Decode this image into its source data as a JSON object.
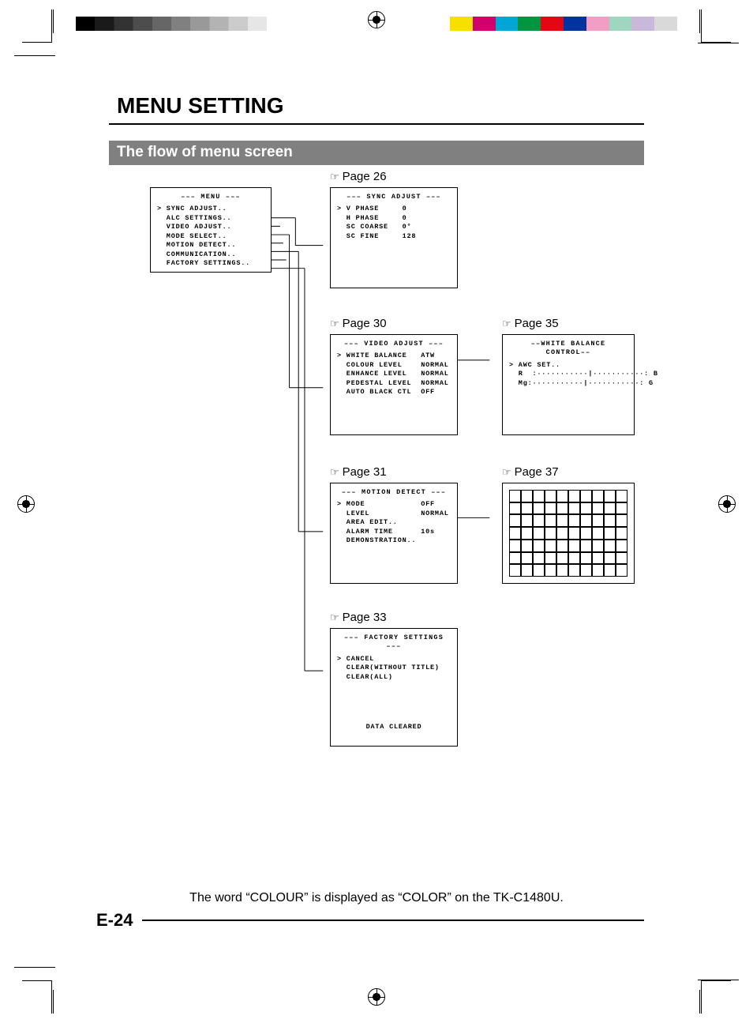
{
  "header": {
    "title": "MENU SETTING",
    "subtitle": "The flow of menu screen"
  },
  "refs": {
    "p26": "Page 26",
    "p30": "Page 30",
    "p31": "Page 31",
    "p33": "Page 33",
    "p35": "Page 35",
    "p37": "Page 37"
  },
  "boxes": {
    "menu": {
      "title": "––– MENU –––",
      "items": [
        "SYNC ADJUST..",
        "ALC SETTINGS..",
        "VIDEO ADJUST..",
        "MODE SELECT..",
        "MOTION DETECT..",
        "COMMUNICATION..",
        "FACTORY SETTINGS.."
      ]
    },
    "sync": {
      "title": "––– SYNC ADJUST –––",
      "rows": [
        {
          "label": "V PHASE",
          "value": "0"
        },
        {
          "label": "H PHASE",
          "value": "0"
        },
        {
          "label": "SC COARSE",
          "value": "0°"
        },
        {
          "label": "SC FINE",
          "value": "128"
        }
      ]
    },
    "video": {
      "title": "––– VIDEO ADJUST –––",
      "rows": [
        {
          "label": "WHITE BALANCE",
          "value": "ATW"
        },
        {
          "label": "COLOUR LEVEL",
          "value": "NORMAL"
        },
        {
          "label": "ENHANCE LEVEL",
          "value": "NORMAL"
        },
        {
          "label": "PEDESTAL LEVEL",
          "value": "NORMAL"
        },
        {
          "label": "AUTO BLACK CTL",
          "value": "OFF"
        }
      ]
    },
    "wb": {
      "title": "––WHITE BALANCE CONTROL––",
      "rows": [
        "AWC SET..",
        "R  :···········|···········: B",
        "Mg:···········|···········: G"
      ]
    },
    "motion": {
      "title": "––– MOTION DETECT –––",
      "rows": [
        {
          "label": "MODE",
          "value": "OFF"
        },
        {
          "label": "LEVEL",
          "value": "NORMAL"
        },
        {
          "label": "AREA EDIT..",
          "value": ""
        },
        {
          "label": "ALARM TIME",
          "value": "10s"
        },
        {
          "label": "DEMONSTRATION..",
          "value": ""
        }
      ]
    },
    "factory": {
      "title": "––– FACTORY SETTINGS –––",
      "rows": [
        "CANCEL",
        "CLEAR(WITHOUT TITLE)",
        "CLEAR(ALL)"
      ],
      "status": "DATA CLEARED"
    }
  },
  "footnote": "The word “COLOUR” is displayed as “COLOR” on the TK-C1480U.",
  "page_number": "E-24",
  "colorbar": [
    "#f7e000",
    "#d1006c",
    "#00a6d6",
    "#009640",
    "#e30613",
    "#0033a0",
    "#f29ec4",
    "#9ed6c0",
    "#c9b8d9",
    "#d9d9d9"
  ]
}
